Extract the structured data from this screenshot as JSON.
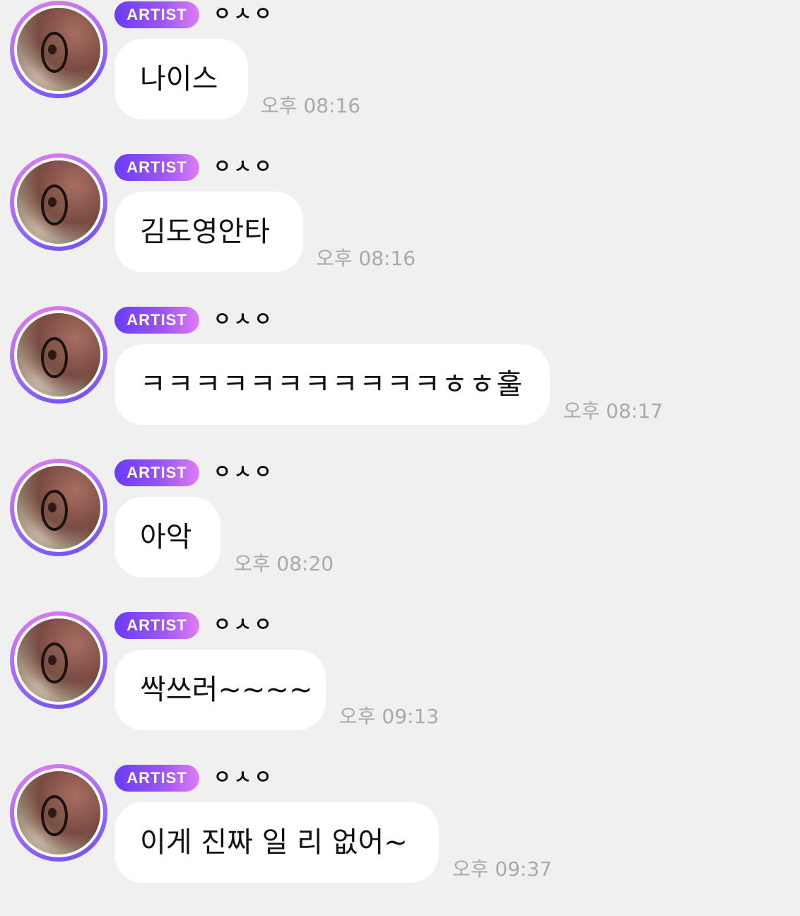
{
  "messages": [
    {
      "badge": "ARTIST",
      "sender": "ㅇㅅㅇ",
      "text": "나이스",
      "time": "오후 08:16"
    },
    {
      "badge": "ARTIST",
      "sender": "ㅇㅅㅇ",
      "text": "김도영안타",
      "time": "오후 08:16"
    },
    {
      "badge": "ARTIST",
      "sender": "ㅇㅅㅇ",
      "text": "ㅋㅋㅋㅋㅋㅋㅋㅋㅋㅋㅋㅎㅎ훌",
      "time": "오후 08:17"
    },
    {
      "badge": "ARTIST",
      "sender": "ㅇㅅㅇ",
      "text": "아악",
      "time": "오후 08:20"
    },
    {
      "badge": "ARTIST",
      "sender": "ㅇㅅㅇ",
      "text": "싹쓰러~~~~",
      "time": "오후 09:13"
    },
    {
      "badge": "ARTIST",
      "sender": "ㅇㅅㅇ",
      "text": "이게 진짜 일 리 없어~",
      "time": "오후 09:37"
    }
  ],
  "colors": {
    "background": "#f0f0f0",
    "bubble": "#ffffff",
    "badge_start": "#6b3cf5",
    "badge_end": "#dd7cf6",
    "timestamp": "#a9a9a9"
  },
  "icons": {
    "avatar": "artist-avatar-photo"
  }
}
